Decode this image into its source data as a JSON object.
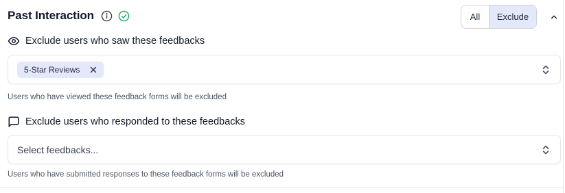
{
  "section": {
    "title": "Past Interaction",
    "icons": [
      "info-icon",
      "check-circle-icon"
    ],
    "check_color": "#22a55a"
  },
  "toggle": {
    "options": [
      "All",
      "Exclude"
    ],
    "selected": "Exclude",
    "active_color": "#e3e8fb"
  },
  "seen": {
    "icon": "eye-icon",
    "label": "Exclude users who saw these feedbacks",
    "selected_items": [
      "5-Star Reviews"
    ],
    "help": "Users who have viewed these feedback forms will be excluded"
  },
  "responded": {
    "icon": "message-square-icon",
    "label": "Exclude users who responded to these feedbacks",
    "placeholder": "Select feedbacks...",
    "help": "Users who have submitted responses to these feedback forms will be excluded"
  }
}
